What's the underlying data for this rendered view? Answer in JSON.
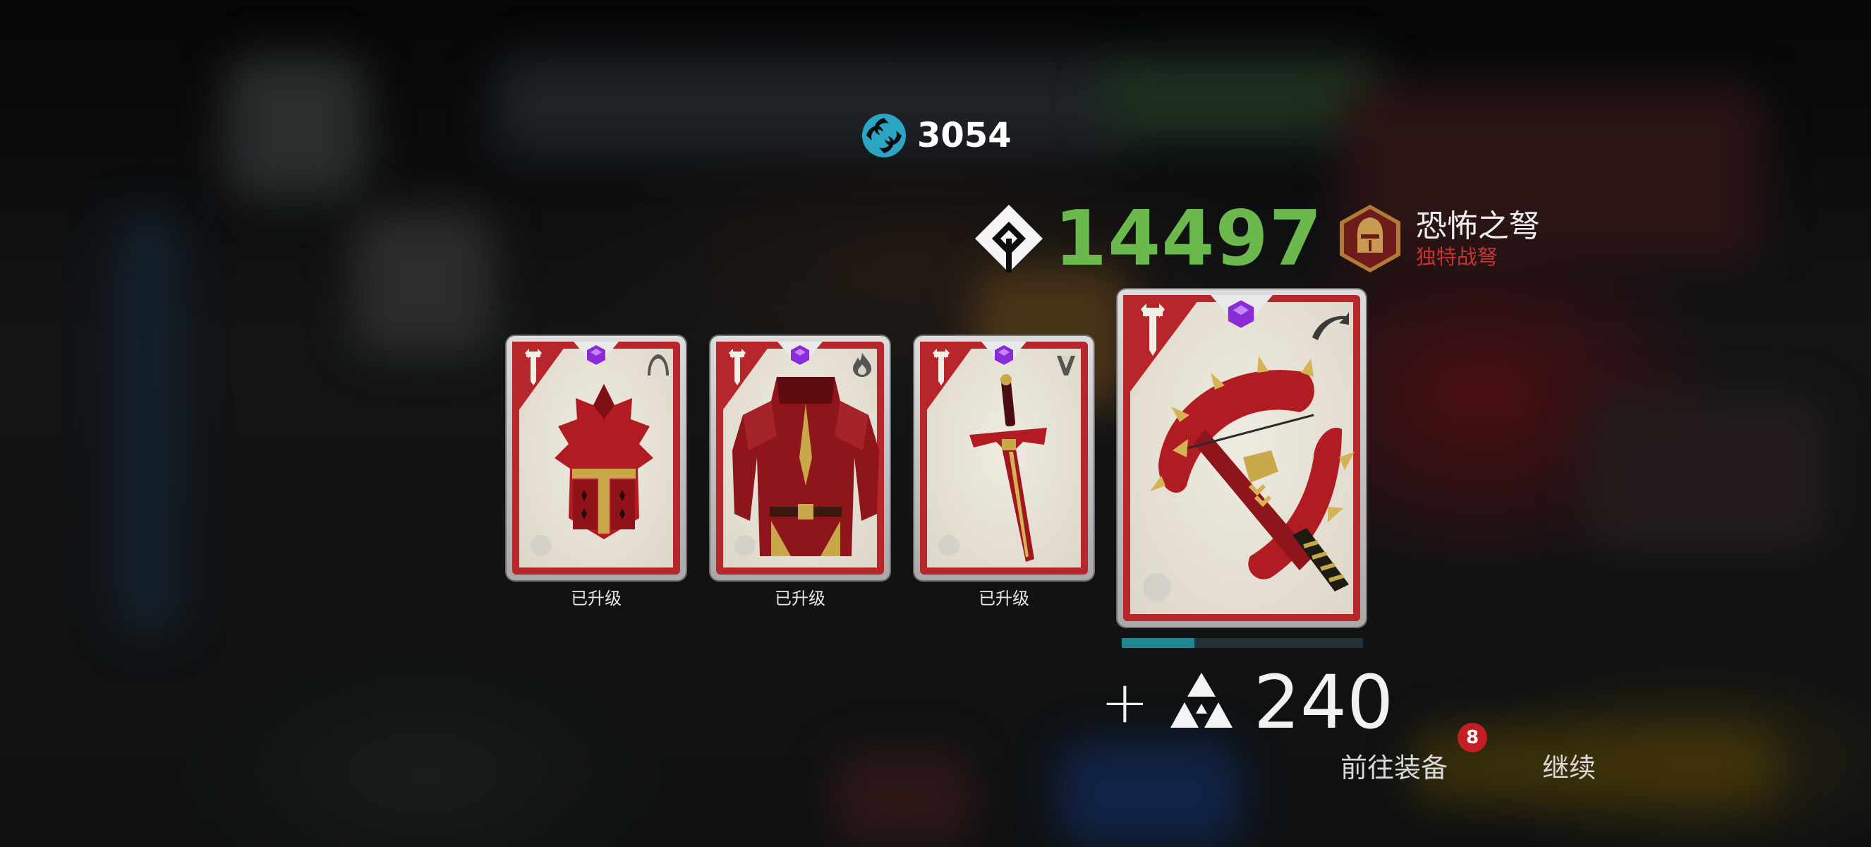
{
  "currency": {
    "icon": "swirl-orb-icon",
    "value": "3054",
    "color": "#2aa6c4"
  },
  "power": {
    "icon": "diamond-power-icon",
    "value": "14497",
    "color": "#6bb84c"
  },
  "item": {
    "emblem_icon": "knight-helmet-emblem-icon",
    "name": "恐怖之弩",
    "subtype": "独特战弩",
    "subtype_color": "#c8322f"
  },
  "cards": [
    {
      "art": "red-helmet",
      "slot_icon": "helmet-slot-icon",
      "rarity_icon": "purple-gem-icon",
      "label": "已升级"
    },
    {
      "art": "red-armor",
      "slot_icon": "flame-slot-icon",
      "rarity_icon": "purple-gem-icon",
      "label": "已升级"
    },
    {
      "art": "red-sword",
      "slot_icon": "weapon-slot-icon",
      "rarity_icon": "purple-gem-icon",
      "label": "已升级"
    },
    {
      "art": "red-crossbow",
      "slot_icon": "ranged-slot-icon",
      "rarity_icon": "purple-gem-icon",
      "label": ""
    }
  ],
  "progress": {
    "fraction": 0.3,
    "fill_color": "#1e8792"
  },
  "gain": {
    "prefix": "+",
    "icon": "triforce-shards-icon",
    "value": "240"
  },
  "buttons": {
    "equip_label": "前往装备",
    "equip_badge": "8",
    "continue_label": "继续"
  },
  "colors": {
    "card_red": "#b7262a",
    "accent_green": "#6bb84c"
  }
}
